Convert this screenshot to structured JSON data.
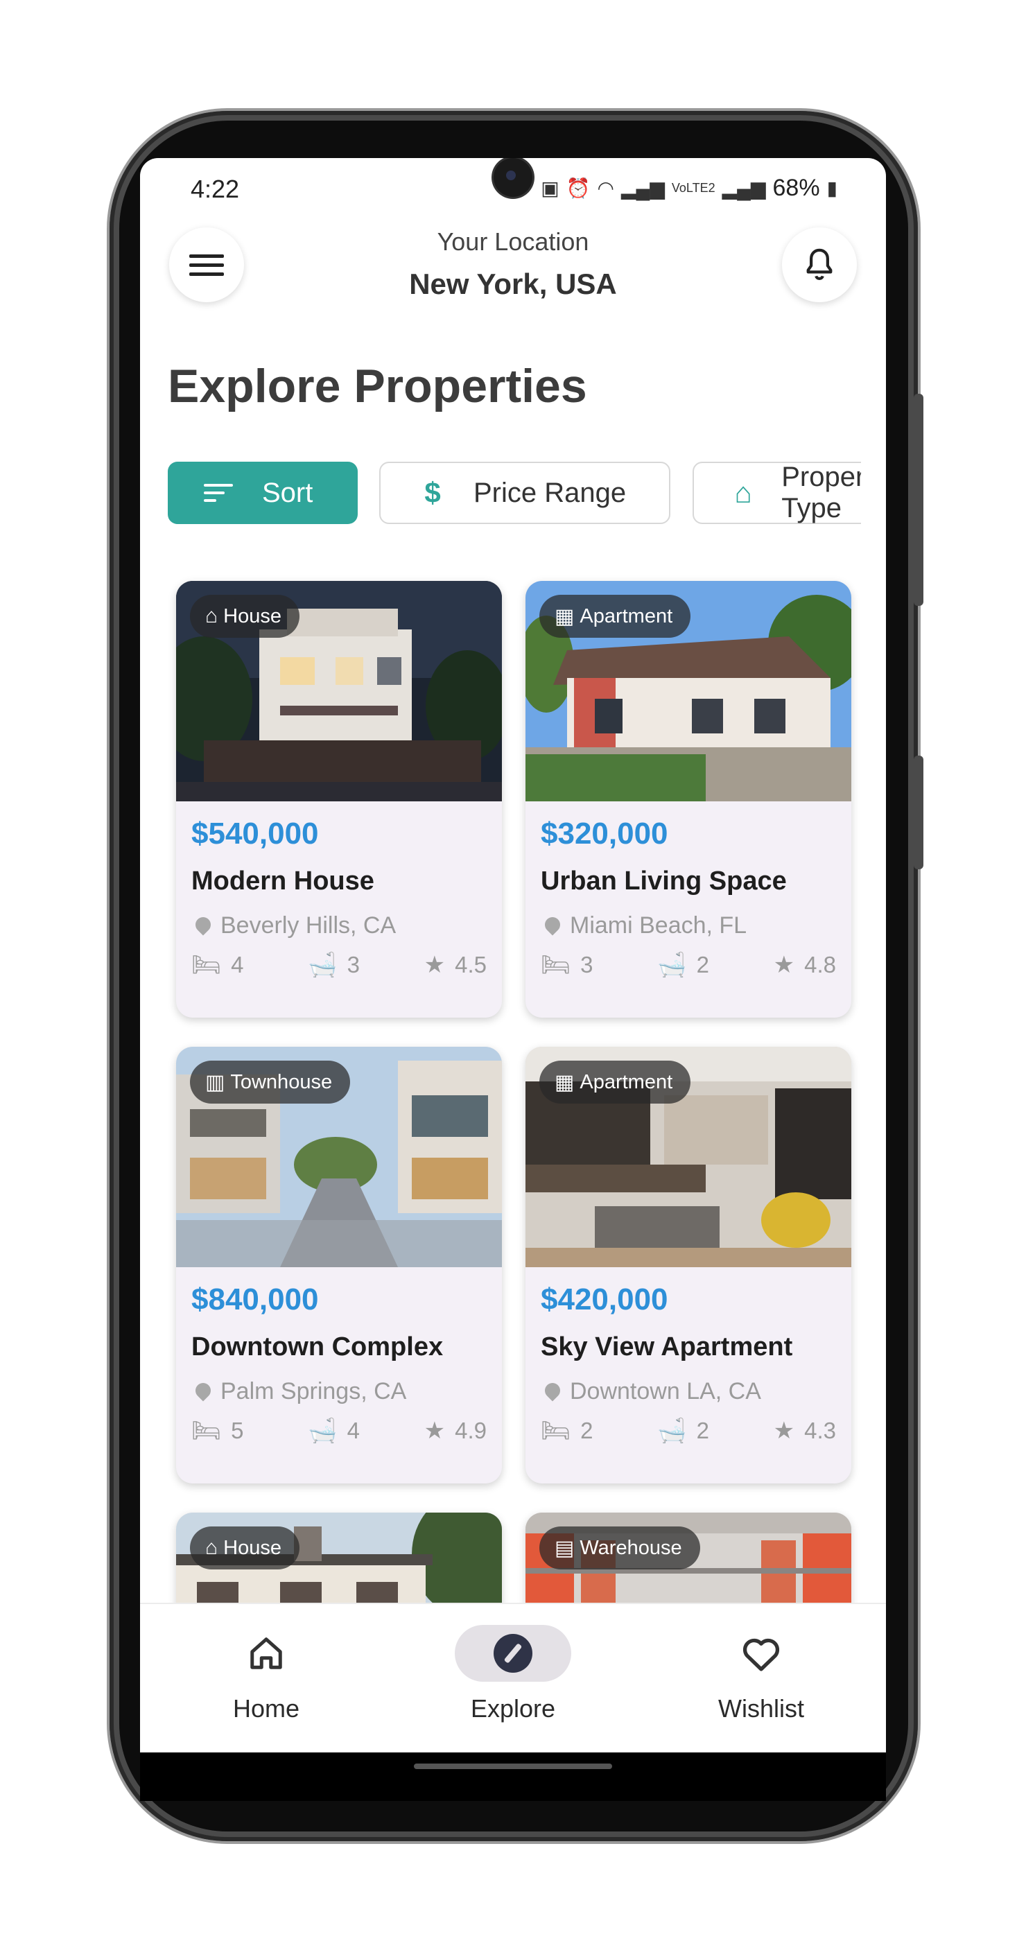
{
  "status_bar": {
    "time": "4:22",
    "battery": "68%",
    "icons": [
      "lock-icon",
      "alarm-icon",
      "wifi-icon",
      "signal-icon",
      "volte-icon",
      "signal-icon",
      "battery-icon"
    ]
  },
  "header": {
    "location_label": "Your Location",
    "location_city": "New York, USA"
  },
  "page_title": "Explore Properties",
  "filters": [
    {
      "label": "Sort",
      "icon": "sort-icon",
      "active": true
    },
    {
      "label": "Price Range",
      "icon": "dollar-icon",
      "active": false
    },
    {
      "label": "Property Type",
      "icon": "home-outline-icon",
      "active": false
    }
  ],
  "properties": [
    {
      "type": "House",
      "price": "$540,000",
      "title": "Modern House",
      "location": "Beverly Hills, CA",
      "beds": "4",
      "baths": "3",
      "rating": "4.5"
    },
    {
      "type": "Apartment",
      "price": "$320,000",
      "title": "Urban Living Space",
      "location": "Miami Beach, FL",
      "beds": "3",
      "baths": "2",
      "rating": "4.8"
    },
    {
      "type": "Townhouse",
      "price": "$840,000",
      "title": "Downtown Complex",
      "location": "Palm Springs, CA",
      "beds": "5",
      "baths": "4",
      "rating": "4.9"
    },
    {
      "type": "Apartment",
      "price": "$420,000",
      "title": "Sky View Apartment",
      "location": "Downtown LA, CA",
      "beds": "2",
      "baths": "2",
      "rating": "4.3"
    },
    {
      "type": "House"
    },
    {
      "type": "Warehouse"
    }
  ],
  "bottom_nav": [
    {
      "label": "Home",
      "icon": "home-icon",
      "active": false
    },
    {
      "label": "Explore",
      "icon": "compass-icon",
      "active": true
    },
    {
      "label": "Wishlist",
      "icon": "heart-icon",
      "active": false
    }
  ],
  "colors": {
    "accent": "#2fa59a",
    "price": "#2d8fd8",
    "card_bg": "#f4f0f7",
    "nav_active_pill": "#e4e1e6"
  }
}
